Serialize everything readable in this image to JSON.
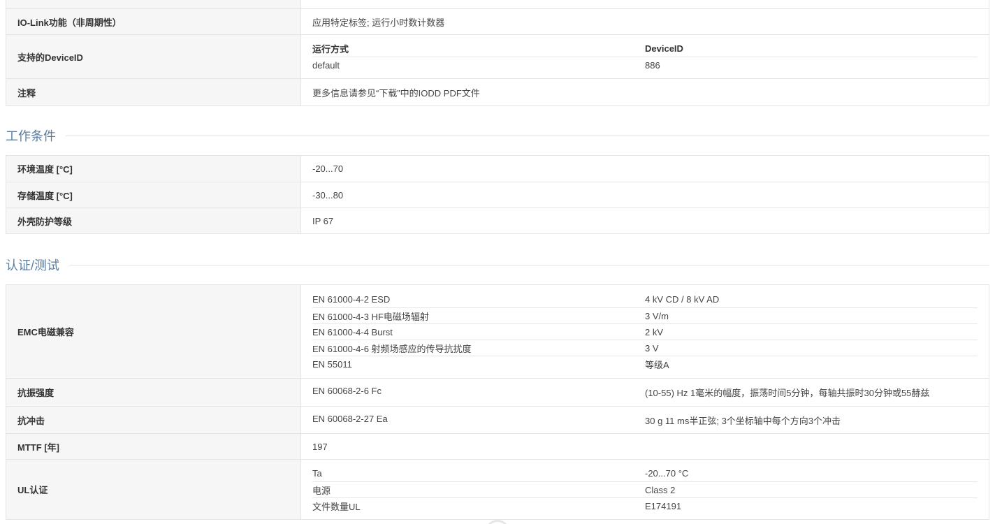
{
  "table1": {
    "rows": [
      {
        "label": "",
        "value": ""
      },
      {
        "label": "IO-Link功能（非周期性）",
        "value": "应用特定标签; 运行小时数计数器"
      },
      {
        "label": "支持的DeviceID",
        "sub": {
          "headers": [
            "运行方式",
            "DeviceID"
          ],
          "rows": [
            [
              "default",
              "886"
            ]
          ]
        }
      },
      {
        "label": "注释",
        "value": "更多信息请参见“下载”中的IODD PDF文件"
      }
    ]
  },
  "section_operating": {
    "title": "工作条件"
  },
  "table2": {
    "rows": [
      {
        "label": "环境温度 [°C]",
        "value": "-20...70"
      },
      {
        "label": "存储温度 [°C]",
        "value": "-30...80"
      },
      {
        "label": "外壳防护等级",
        "value": "IP 67"
      }
    ]
  },
  "section_tests": {
    "title": "认证/测试"
  },
  "table3": {
    "emc": {
      "label": "EMC电磁兼容",
      "rows": [
        [
          "EN 61000-4-2 ESD",
          "4 kV CD / 8 kV AD"
        ],
        [
          "EN 61000-4-3 HF电磁场辐射",
          "3 V/m"
        ],
        [
          "EN 61000-4-4 Burst",
          "2 kV"
        ],
        [
          "EN 61000-4-6 射频场感应的传导抗扰度",
          "3 V"
        ],
        [
          "EN 55011",
          "等级A"
        ]
      ]
    },
    "vibration": {
      "label": "抗振强度",
      "c1": "EN 60068-2-6 Fc",
      "c2": "(10-55) Hz 1毫米的幅度，振荡时间5分钟，每轴共振时30分钟或55赫兹"
    },
    "shock": {
      "label": "抗冲击",
      "c1": "EN 60068-2-27 Ea",
      "c2": "30 g 11 ms半正弦; 3个坐标轴中每个方向3个冲击"
    },
    "mttf": {
      "label": "MTTF [年]",
      "value": "197"
    },
    "ul": {
      "label": "UL认证",
      "rows": [
        [
          "Ta",
          "-20...70 °C"
        ],
        [
          "电源",
          "Class 2"
        ],
        [
          "文件数量UL",
          "E174191"
        ]
      ]
    }
  }
}
